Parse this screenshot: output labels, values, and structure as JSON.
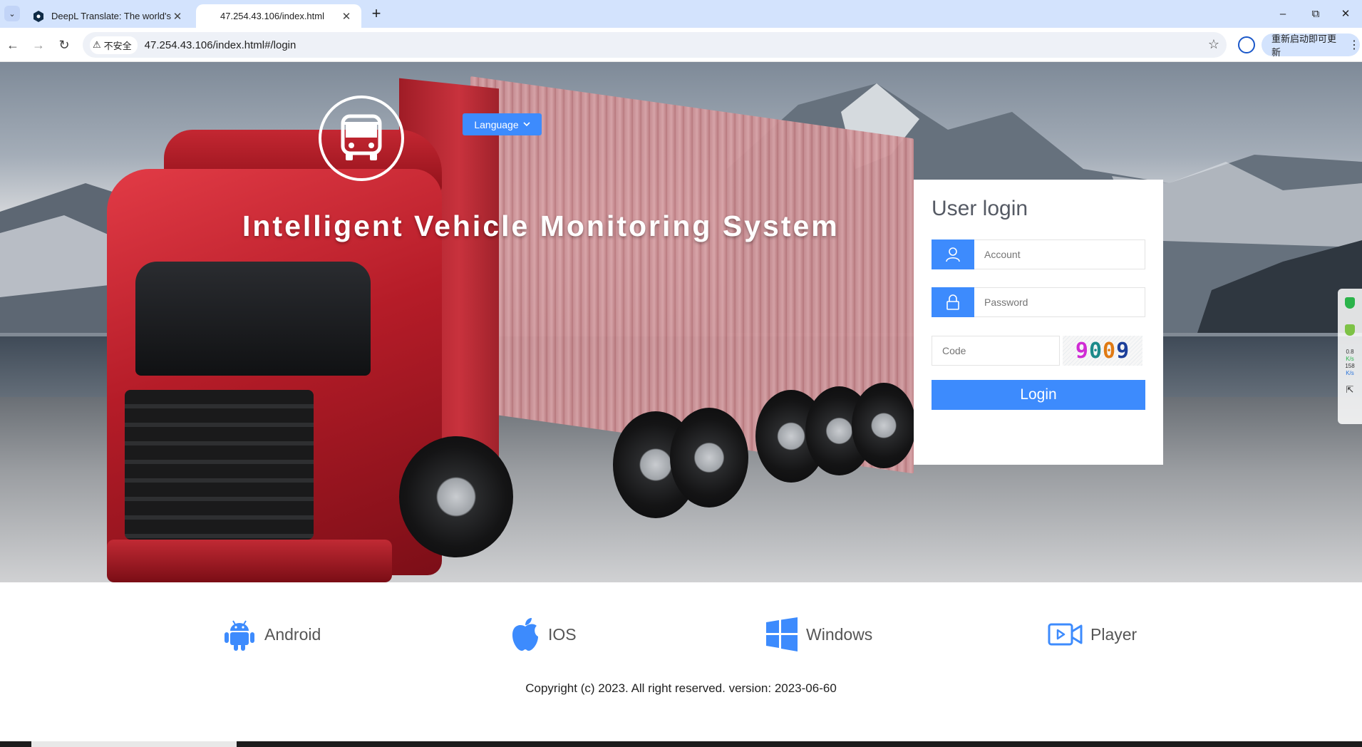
{
  "browser": {
    "tabs": [
      {
        "title": "DeepL Translate: The world's",
        "active": false
      },
      {
        "title": "47.254.43.106/index.html",
        "active": true
      }
    ],
    "security_label": "不安全",
    "url": "47.254.43.106/index.html#/login",
    "update_label": "重新启动即可更新"
  },
  "header": {
    "language_label": "Language",
    "system_title": "Intelligent Vehicle Monitoring System"
  },
  "login": {
    "title": "User login",
    "account_placeholder": "Account",
    "password_placeholder": "Password",
    "code_placeholder": "Code",
    "captcha_text": [
      "9",
      "0",
      "0",
      "9"
    ],
    "button_label": "Login"
  },
  "side_widget": {
    "up_value": "0.8",
    "up_unit": "K/s",
    "down_value": "158",
    "down_unit": "K/s"
  },
  "platforms": [
    {
      "label": "Android",
      "icon": "android-icon"
    },
    {
      "label": "IOS",
      "icon": "apple-icon"
    },
    {
      "label": "Windows",
      "icon": "windows-icon"
    },
    {
      "label": "Player",
      "icon": "video-player-icon"
    }
  ],
  "footer": {
    "copyright": "Copyright (c) 2023. All right reserved. version: 2023-06-60"
  },
  "colors": {
    "accent": "#3d8bfd",
    "tabbar": "#d3e3fd"
  }
}
